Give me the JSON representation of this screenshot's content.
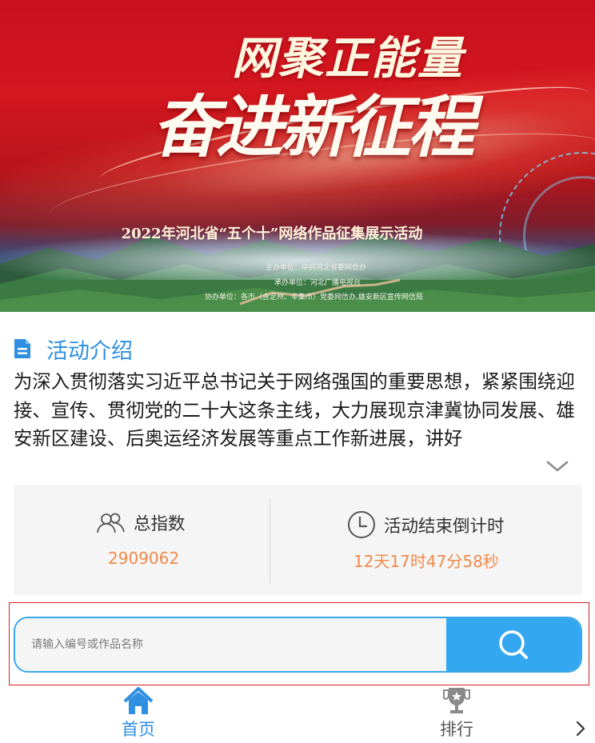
{
  "banner": {
    "title_line1": "网聚正能量",
    "title_line2": "奋进新征程",
    "subtitle": "2022年河北省“五个十”网络作品征集展示活动",
    "host": "主办单位：中共河北省委网信办",
    "organizer": "承办单位：河北广播电视台",
    "co_organizer": "协办单位：各市（含定州、辛集市）党委网信办,雄安新区宣传网信局"
  },
  "intro": {
    "title": "活动介绍",
    "text": "为深入贯彻落实习近平总书记关于网络强国的重要思想，紧紧围绕迎接、宣传、贯彻党的二十大这条主线，大力展现京津冀协同发展、雄安新区建设、后奥运经济发展等重点工作新进展，讲好"
  },
  "stats": {
    "total_label": "总指数",
    "total_value": "2909062",
    "countdown_label": "活动结束倒计时",
    "countdown_value": "12天17时47分58秒"
  },
  "search": {
    "placeholder": "请输入编号或作品名称",
    "value": ""
  },
  "nav": {
    "home_label": "首页",
    "rank_label": "排行"
  },
  "colors": {
    "accent_blue": "#2f8fe0",
    "search_blue": "#33a7ef",
    "value_orange": "#f08a4b",
    "highlight_red": "#d9201f"
  }
}
